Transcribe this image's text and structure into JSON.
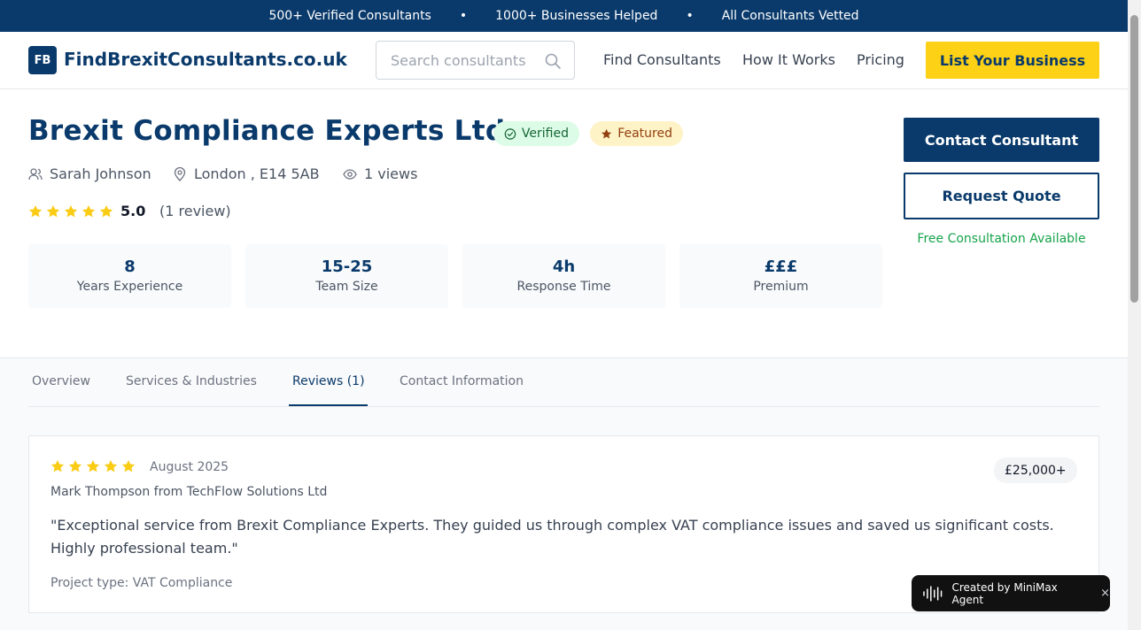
{
  "topbar": {
    "items": [
      "500+ Verified Consultants",
      "1000+ Businesses Helped",
      "All Consultants Vetted"
    ],
    "separator": "•"
  },
  "header": {
    "logo_initials": "FB",
    "logo_text": "FindBrexitConsultants.co.uk",
    "search_placeholder": "Search consultants",
    "nav": [
      "Find Consultants",
      "How It Works",
      "Pricing"
    ],
    "cta": "List Your Business"
  },
  "profile": {
    "name": "Brexit Compliance Experts Ltd",
    "badges": {
      "verified": "Verified",
      "featured": "Featured"
    },
    "contact_person": "Sarah Johnson",
    "location": "London , E14 5AB",
    "views": "1 views",
    "rating": "5.0",
    "stars": 5,
    "review_count": "(1 review)",
    "stats": [
      {
        "value": "8",
        "label": "Years Experience"
      },
      {
        "value": "15-25",
        "label": "Team Size"
      },
      {
        "value": "4h",
        "label": "Response Time"
      },
      {
        "value": "£££",
        "label": "Premium"
      }
    ],
    "actions": {
      "contact": "Contact Consultant",
      "quote": "Request Quote",
      "free_consultation": "Free Consultation Available"
    }
  },
  "tabs": {
    "items": [
      "Overview",
      "Services & Industries",
      "Reviews (1)",
      "Contact Information"
    ],
    "active": "Reviews (1)"
  },
  "review": {
    "stars": 5,
    "date": "August 2025",
    "author": "Mark Thompson from TechFlow Solutions Ltd",
    "budget": "£25,000+",
    "text": "\"Exceptional service from Brexit Compliance Experts. They guided us through complex VAT compliance issues and saved us significant costs. Highly professional team.\"",
    "project_type": "Project type: VAT Compliance"
  },
  "toast": {
    "label": "Created by MiniMax Agent",
    "close": "×"
  },
  "colors": {
    "brand_navy": "#0a3a6b",
    "cta_yellow": "#fcd116",
    "star_yellow": "#facc15",
    "verified_green": "#16a34a"
  }
}
